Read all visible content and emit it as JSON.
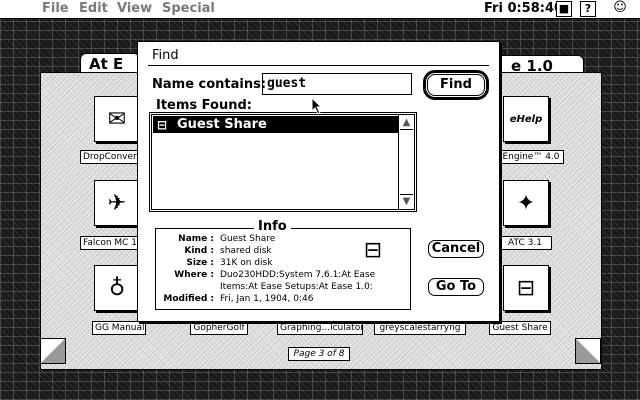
{
  "menubar": {
    "apple_glyph": "",
    "items": [
      "File",
      "Edit",
      "View",
      "Special"
    ],
    "clock": "Fri 0:58:40",
    "help_glyph": "?",
    "app_glyph": "■"
  },
  "atease": {
    "tab_left_visible": "At E",
    "tab_right_visible": "e 1.0",
    "page_indicator": "Page 3 of 8",
    "apps": [
      {
        "label": "DropConvert",
        "glyph": "✉"
      },
      {
        "label": "Falcon MC 1",
        "glyph": "✈"
      },
      {
        "label": "GG Manual",
        "glyph": "♁"
      },
      {
        "label": "GopherGolf"
      },
      {
        "label": "Graphing...lculator"
      },
      {
        "label": "greyscalestarryng"
      },
      {
        "label": "Engine™ 4.0",
        "glyph": "eHelp"
      },
      {
        "label": "ATC 3.1",
        "glyph": "✦"
      },
      {
        "label": "Guest Share",
        "glyph": "⊟"
      }
    ]
  },
  "find": {
    "title": "Find",
    "name_contains_label": "Name contains:",
    "query": "guest",
    "find_button": "Find",
    "items_found_label": "Items Found:",
    "results": [
      {
        "name": "Guest Share",
        "glyph": "⊟"
      }
    ],
    "cancel_button": "Cancel",
    "goto_button": "Go To",
    "info": {
      "title": "Info",
      "name_key": "Name :",
      "name": "Guest Share",
      "kind_key": "Kind :",
      "kind": "shared disk",
      "size_key": "Size :",
      "size": "31K on disk",
      "where_key": "Where :",
      "where_1": "Duo230HDD:System 7.6.1:At Ease",
      "where_2": "Items:At Ease Setups:At Ease 1.0:",
      "modified_key": "Modified :",
      "modified": "Fri, Jan 1, 1904, 0:46"
    }
  }
}
